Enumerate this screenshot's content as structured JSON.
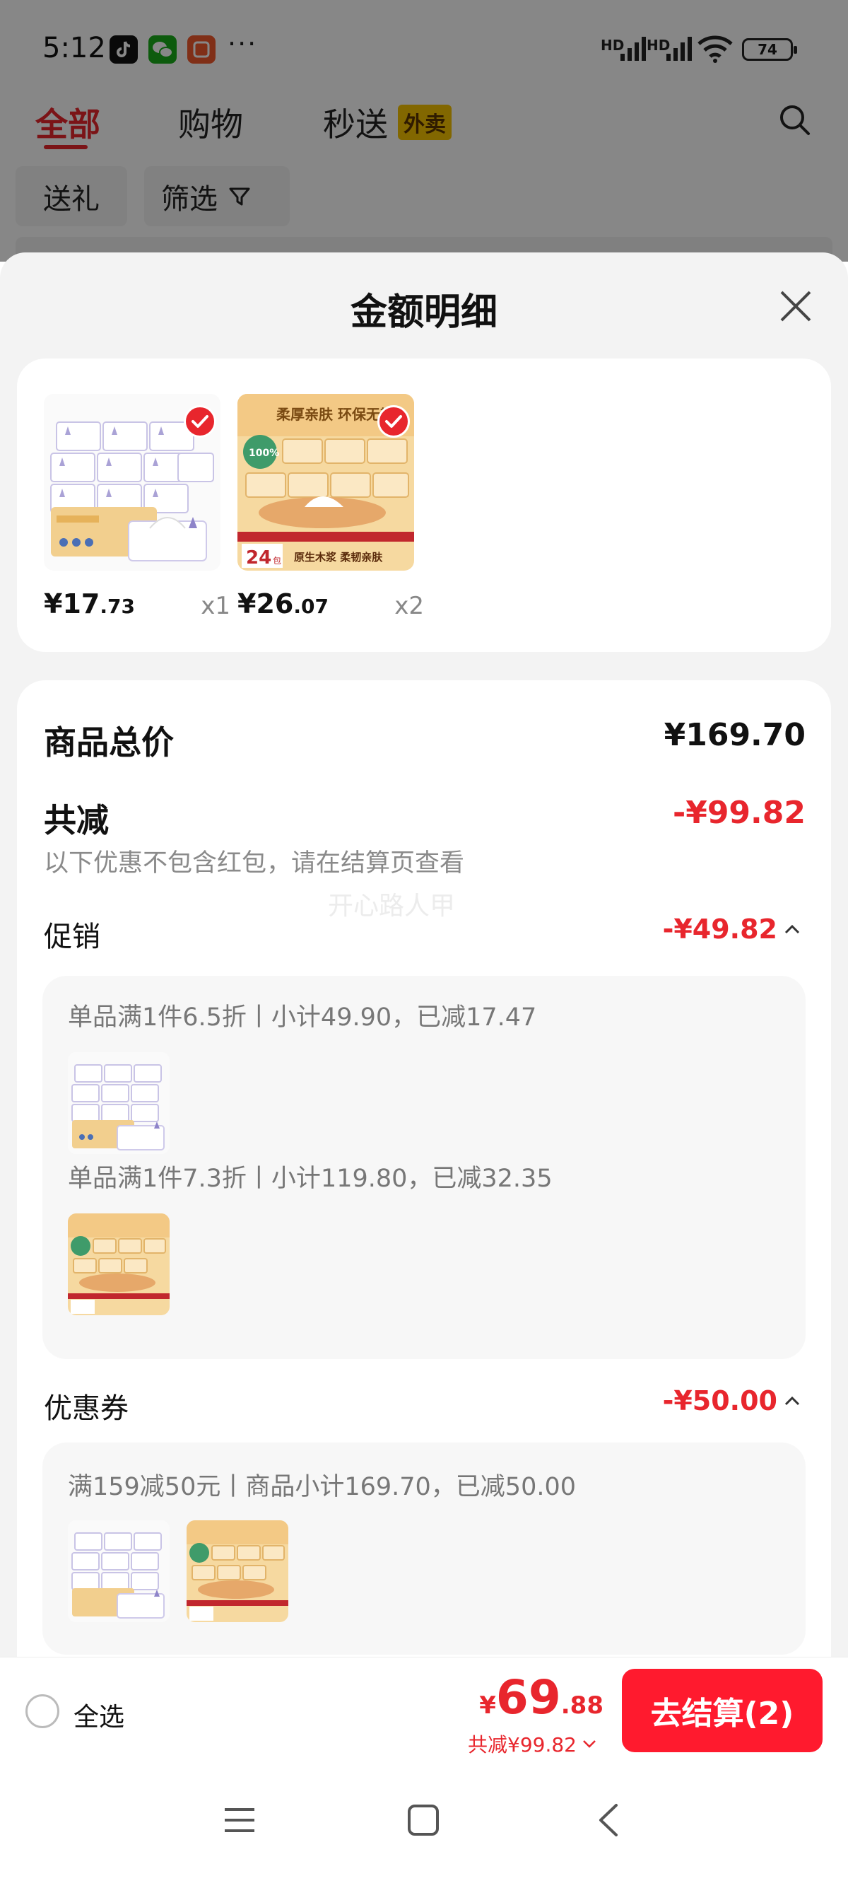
{
  "status_bar": {
    "time": "5:12",
    "network_1": "HD",
    "network_2": "HD",
    "battery": "74",
    "overflow_dots": "···"
  },
  "background": {
    "tabs": [
      {
        "label": "全部",
        "active": true
      },
      {
        "label": "购物",
        "active": false
      },
      {
        "label": "秒送",
        "active": false
      }
    ],
    "waimai_badge": "外卖",
    "chips": [
      {
        "label": "送礼"
      },
      {
        "label": "筛选"
      }
    ]
  },
  "sheet": {
    "title": "金额明细",
    "products": [
      {
        "price_int": "¥17",
        "price_dec": ".73",
        "qty": "x1"
      },
      {
        "price_int": "¥26",
        "price_dec": ".07",
        "qty": "x2"
      }
    ],
    "total_label": "商品总价",
    "total_value": "¥169.70",
    "discount_label": "共减",
    "discount_value": "-¥99.82",
    "discount_note": "以下优惠不包含红包，请在结算页查看",
    "watermark": "开心路人甲",
    "promo": {
      "label": "促销",
      "value": "-¥49.82",
      "items": [
        {
          "text": "单品满1件6.5折丨小计49.90，已减17.47"
        },
        {
          "text": "单品满1件7.3折丨小计119.80，已减32.35"
        }
      ]
    },
    "coupon": {
      "label": "优惠券",
      "value": "-¥50.00",
      "text": "满159减50元丨商品小计169.70，已减50.00"
    },
    "product_art": {
      "banner_text": "柔厚亲肤 环保无散",
      "badge_text": "100%",
      "count_text": "24",
      "count_unit": "包",
      "bottom_text": "原生木浆 柔韧亲肤"
    }
  },
  "bottom_bar": {
    "select_all": "全选",
    "total_yen": "¥",
    "total_int": "69",
    "total_dec": ".88",
    "saved_text": "共减¥99.82",
    "checkout_label": "去结算(2)"
  },
  "colors": {
    "accent_red": "#e8262d",
    "checkout_red": "#ff1a2e",
    "waimai_yellow": "#f6c300"
  }
}
